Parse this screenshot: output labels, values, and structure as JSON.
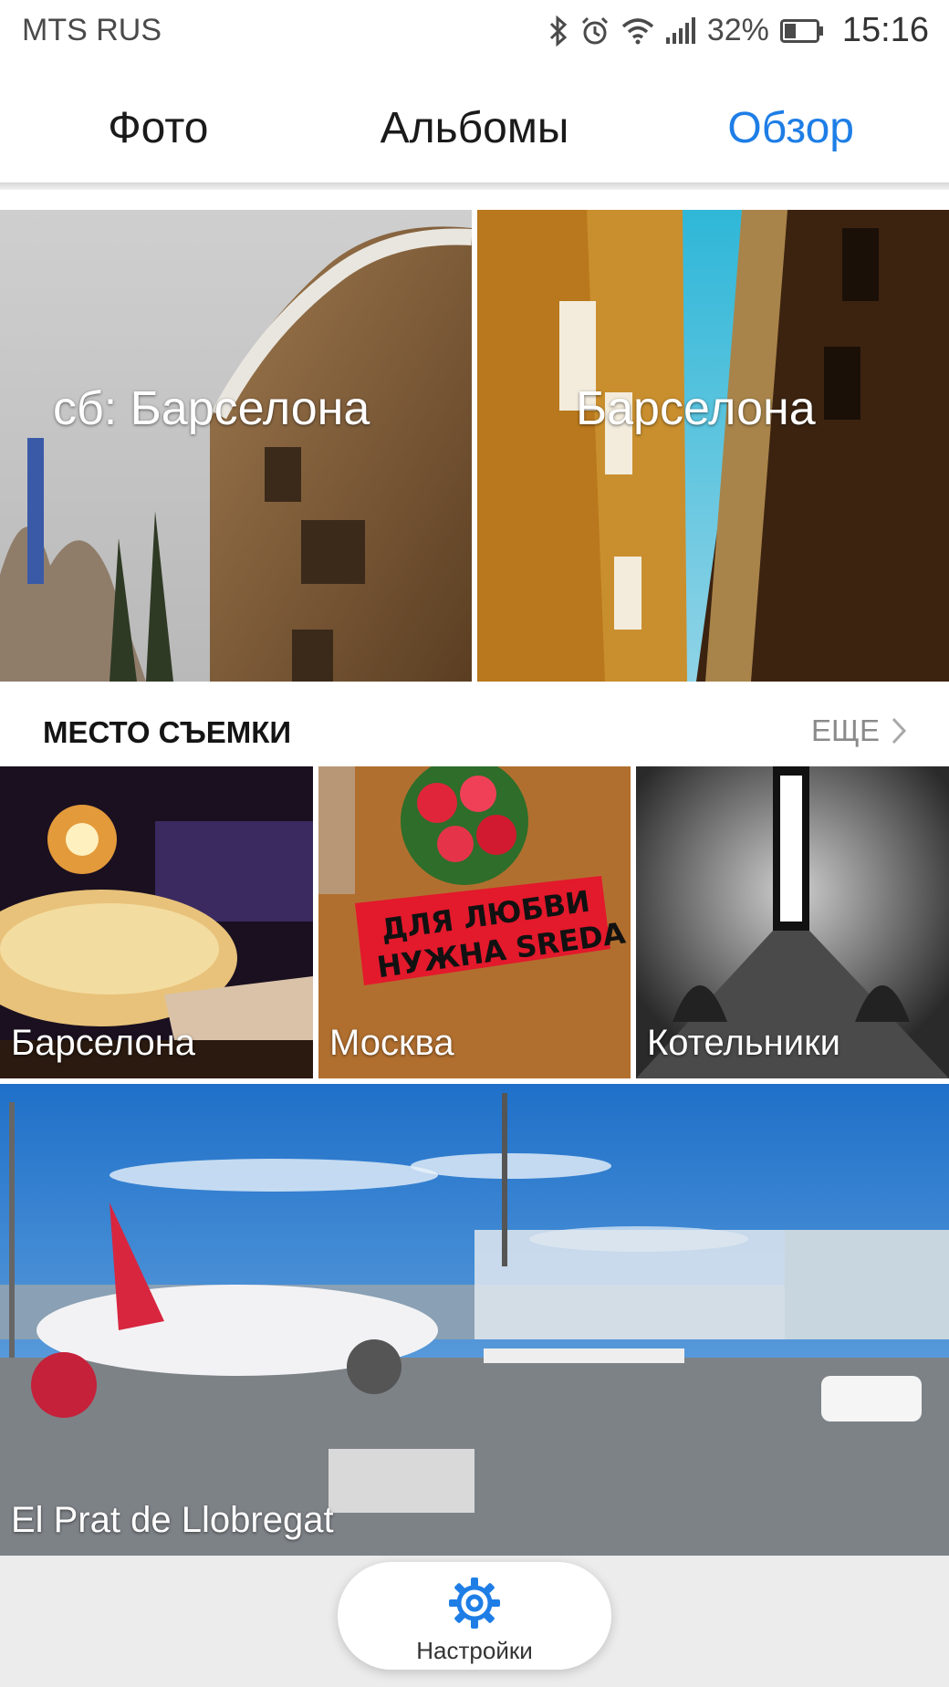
{
  "status_bar": {
    "carrier": "MTS RUS",
    "battery_percent": "32%",
    "time": "15:16",
    "icons": [
      "bluetooth-icon",
      "alarm-icon",
      "wifi-icon",
      "signal-icon",
      "battery-icon"
    ]
  },
  "tabs": [
    {
      "label": "Фото",
      "active": false
    },
    {
      "label": "Альбомы",
      "active": false
    },
    {
      "label": "Обзор",
      "active": true
    }
  ],
  "accent_color": "#1e7ee6",
  "top_section": {
    "partially_visible": true,
    "tiles": [
      {
        "label": "сб: Барселона"
      },
      {
        "label": "Барселона"
      }
    ]
  },
  "places": {
    "title": "МЕСТО СЪЕМКИ",
    "more_label": "ЕЩЕ",
    "tiles": [
      {
        "label": "Барселона"
      },
      {
        "label": "Москва"
      },
      {
        "label": "Котельники"
      },
      {
        "label": "El Prat de Llobregat"
      }
    ]
  },
  "bottom_bar": {
    "settings_label": "Настройки",
    "icon": "gear-icon"
  }
}
